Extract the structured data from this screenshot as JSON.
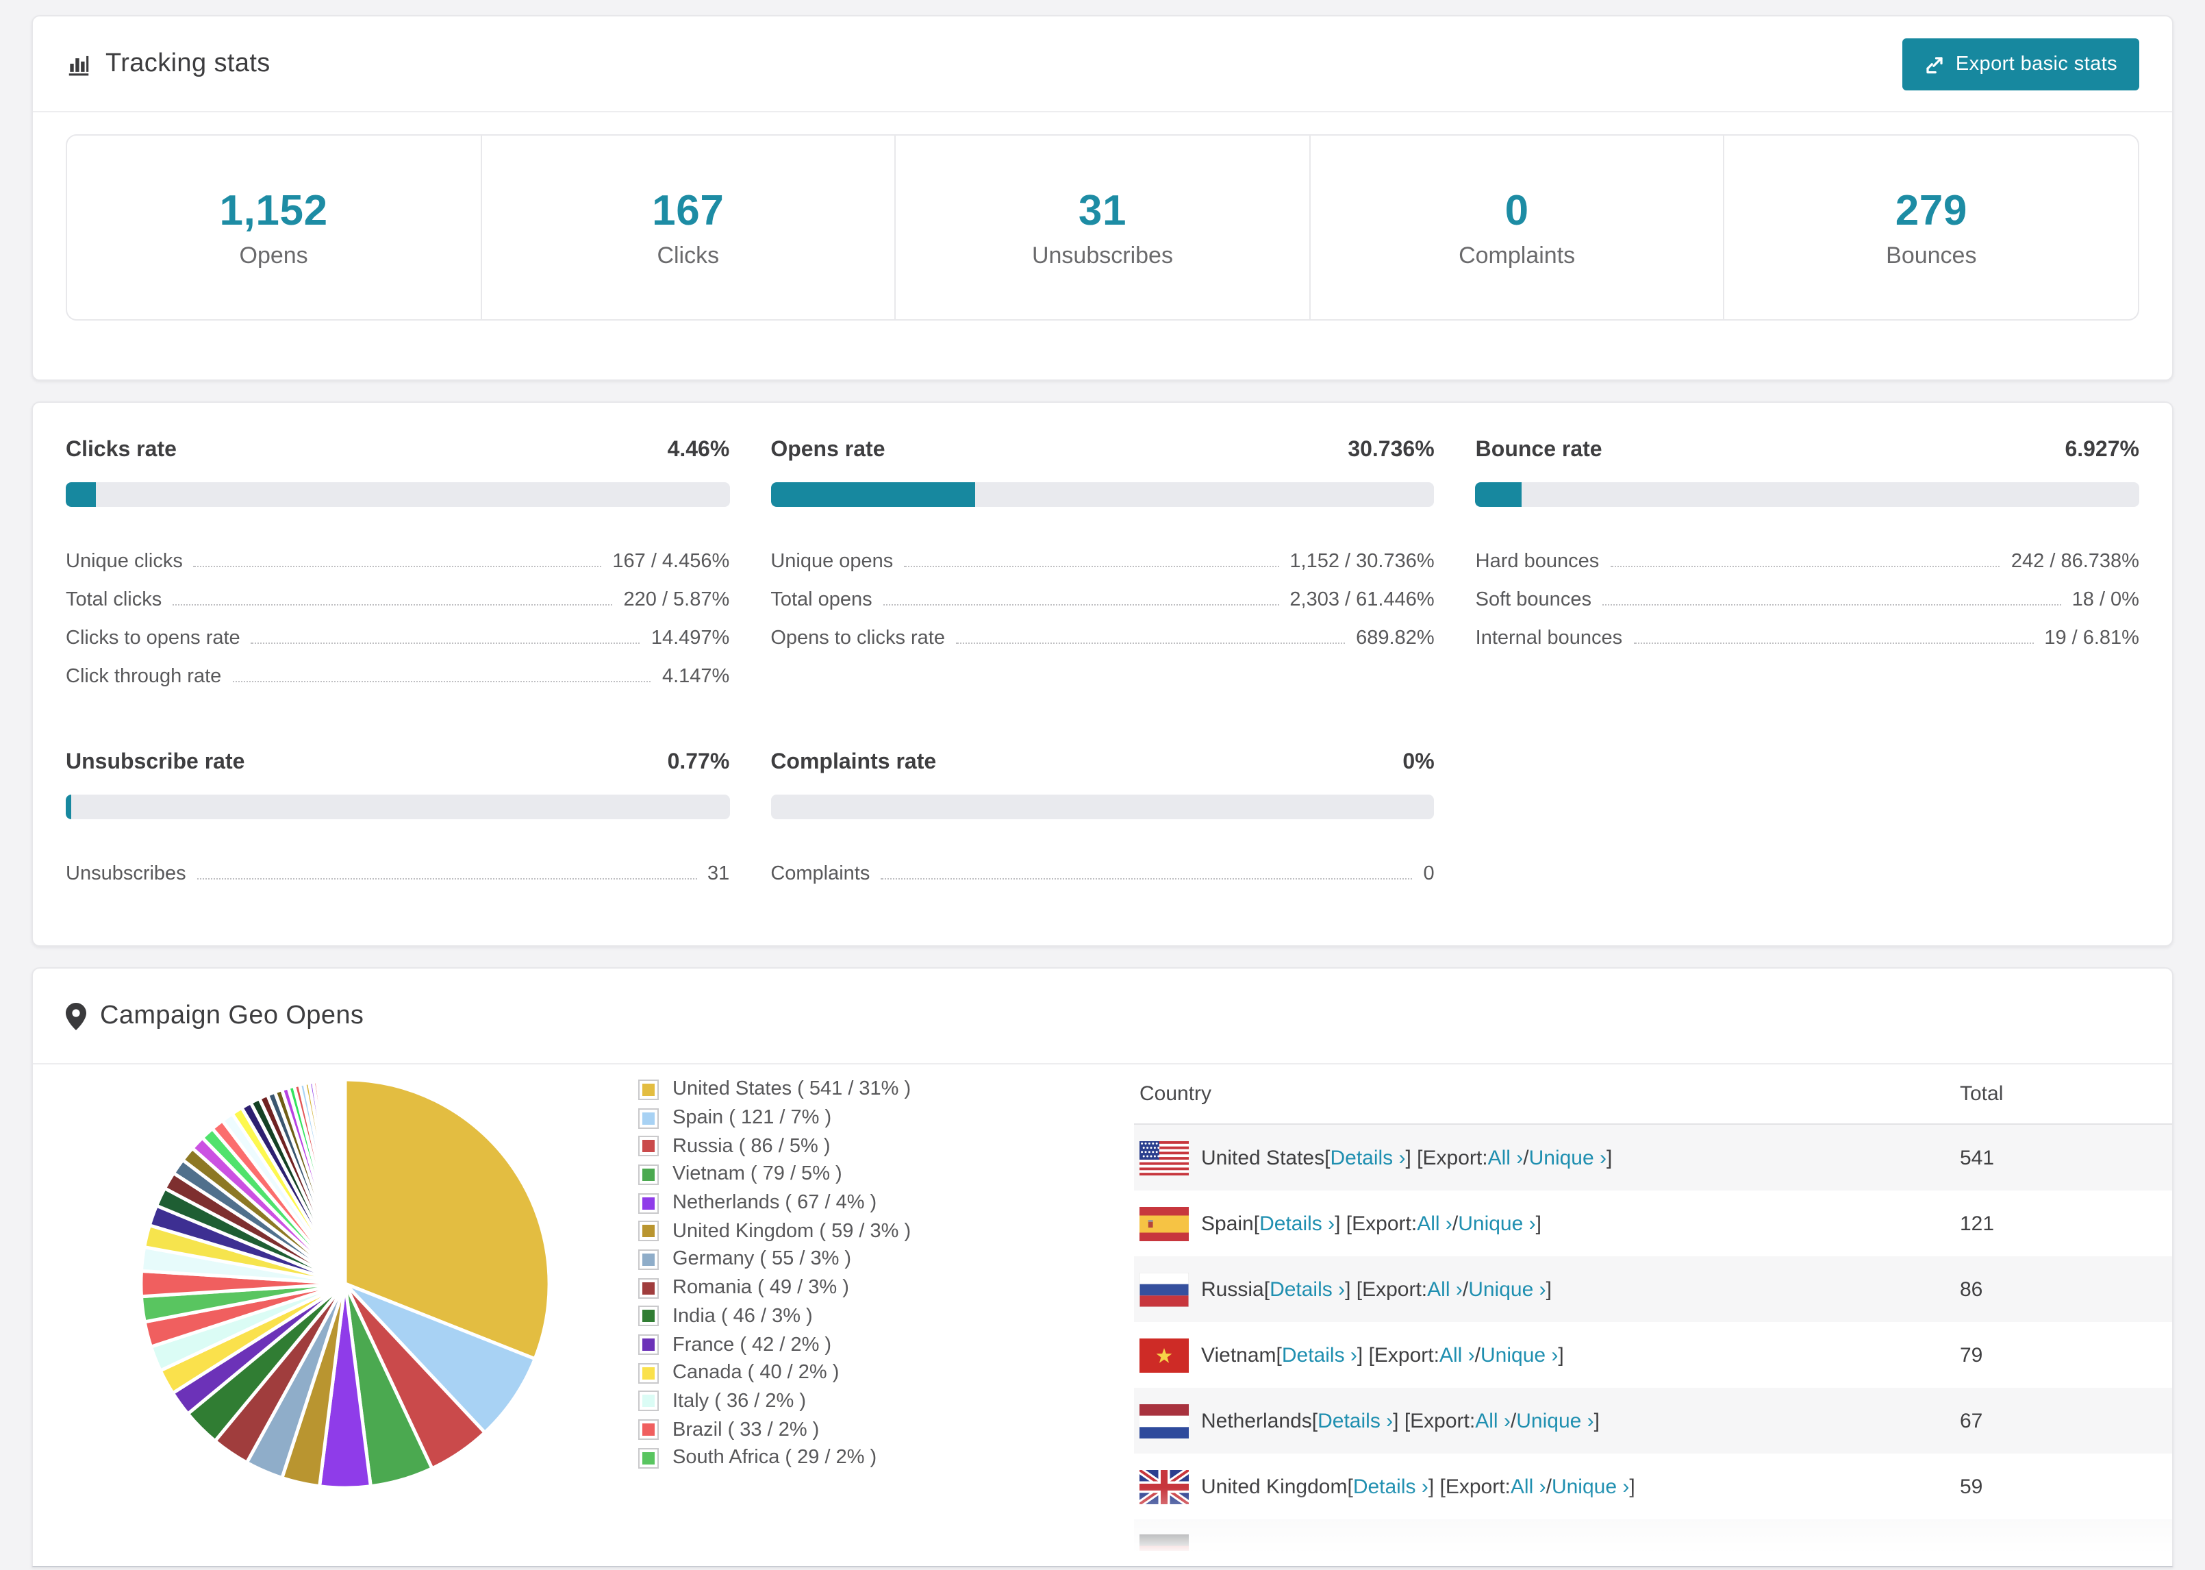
{
  "colors": {
    "accent": "#17889f",
    "stat_number": "#1d8ca4",
    "link": "#1f8fb0",
    "bar_track": "#e9eaee"
  },
  "header": {
    "title": "Tracking stats",
    "export_label": "Export basic stats"
  },
  "summary": [
    {
      "value": "1,152",
      "label": "Opens"
    },
    {
      "value": "167",
      "label": "Clicks"
    },
    {
      "value": "31",
      "label": "Unsubscribes"
    },
    {
      "value": "0",
      "label": "Complaints"
    },
    {
      "value": "279",
      "label": "Bounces"
    }
  ],
  "rates": [
    {
      "title": "Clicks rate",
      "value": "4.46%",
      "pct": 4.46,
      "rows": [
        [
          "Unique clicks",
          "167 / 4.456%"
        ],
        [
          "Total clicks",
          "220 / 5.87%"
        ],
        [
          "Clicks to opens rate",
          "14.497%"
        ],
        [
          "Click through rate",
          "4.147%"
        ]
      ]
    },
    {
      "title": "Opens rate",
      "value": "30.736%",
      "pct": 30.736,
      "rows": [
        [
          "Unique opens",
          "1,152 / 30.736%"
        ],
        [
          "Total opens",
          "2,303 / 61.446%"
        ],
        [
          "Opens to clicks rate",
          "689.82%"
        ]
      ]
    },
    {
      "title": "Bounce rate",
      "value": "6.927%",
      "pct": 6.927,
      "rows": [
        [
          "Hard bounces",
          "242 / 86.738%"
        ],
        [
          "Soft bounces",
          "18 / 0%"
        ],
        [
          "Internal bounces",
          "19 / 6.81%"
        ]
      ]
    },
    {
      "title": "Unsubscribe rate",
      "value": "0.77%",
      "pct": 0.77,
      "rows": [
        [
          "Unsubscribes",
          "31"
        ]
      ]
    },
    {
      "title": "Complaints rate",
      "value": "0%",
      "pct": 0,
      "rows": [
        [
          "Complaints",
          "0"
        ]
      ]
    }
  ],
  "geo": {
    "title": "Campaign Geo Opens",
    "columns": [
      "Country",
      "Total"
    ],
    "row_parts": {
      "p1": " [",
      "details": "Details ›",
      "p2": "] [Export: ",
      "all": "All ›",
      "p3": " / ",
      "unique": "Unique ›",
      "p4": "]"
    },
    "rows": [
      {
        "country": "United States",
        "flag": "us",
        "total": "541"
      },
      {
        "country": "Spain",
        "flag": "es",
        "total": "121"
      },
      {
        "country": "Russia",
        "flag": "ru",
        "total": "86"
      },
      {
        "country": "Vietnam",
        "flag": "vn",
        "total": "79"
      },
      {
        "country": "Netherlands",
        "flag": "nl",
        "total": "67"
      },
      {
        "country": "United Kingdom",
        "flag": "gb",
        "total": "59"
      },
      {
        "country": "",
        "flag": "de",
        "total": "",
        "partial": true
      }
    ]
  },
  "chart_data": {
    "type": "pie",
    "title": "Campaign Geo Opens",
    "unit": "opens",
    "legend_position": "right",
    "slices": [
      {
        "label": "United States",
        "value": 541,
        "pct": 31,
        "color": "#e3bd41"
      },
      {
        "label": "Spain",
        "value": 121,
        "pct": 7,
        "color": "#a8d2f4"
      },
      {
        "label": "Russia",
        "value": 86,
        "pct": 5,
        "color": "#ca4a4b"
      },
      {
        "label": "Vietnam",
        "value": 79,
        "pct": 5,
        "color": "#4ba950"
      },
      {
        "label": "Netherlands",
        "value": 67,
        "pct": 4,
        "color": "#8f3ce9"
      },
      {
        "label": "United Kingdom",
        "value": 59,
        "pct": 3,
        "color": "#b99530"
      },
      {
        "label": "Germany",
        "value": 55,
        "pct": 3,
        "color": "#8fadc9"
      },
      {
        "label": "Romania",
        "value": 49,
        "pct": 3,
        "color": "#a03d3d"
      },
      {
        "label": "India",
        "value": 46,
        "pct": 3,
        "color": "#307d33"
      },
      {
        "label": "France",
        "value": 42,
        "pct": 2,
        "color": "#6c32b8"
      },
      {
        "label": "Canada",
        "value": 40,
        "pct": 2,
        "color": "#fae14c"
      },
      {
        "label": "Italy",
        "value": 36,
        "pct": 2,
        "color": "#dbfcf5"
      },
      {
        "label": "Brazil",
        "value": 33,
        "pct": 2,
        "color": "#f05f5f"
      },
      {
        "label": "South Africa",
        "value": 29,
        "pct": 2,
        "color": "#59c560"
      }
    ],
    "other_slices_pct": [
      1.6,
      1.5,
      1.4,
      1.3,
      1.2,
      1.1,
      1.0,
      0.95,
      0.9,
      0.85,
      0.8,
      0.75,
      0.7,
      0.65,
      0.6,
      0.55,
      0.5,
      0.46,
      0.42,
      0.38,
      0.35,
      0.32,
      0.29,
      0.26,
      0.24,
      0.22,
      0.2,
      0.18,
      0.16,
      0.14,
      0.13,
      0.12,
      0.11,
      0.1,
      0.09,
      0.08,
      0.07,
      0.06,
      0.05,
      0.05
    ],
    "other_colors": [
      "#f05f5f",
      "#e7fbfb",
      "#f6e44d",
      "#3d2f92",
      "#1e5e33",
      "#7e2f2f",
      "#50708c",
      "#8d7824",
      "#cb52e2",
      "#50e26c",
      "#fb6d6d",
      "#eefcff",
      "#fdf84f",
      "#2d1f70",
      "#144124",
      "#702222",
      "#3a5670",
      "#6f5e16",
      "#b742e2",
      "#33e25e",
      "#e25555",
      "#a8d2f4",
      "#d6b43e",
      "#8f3ce9"
    ]
  }
}
